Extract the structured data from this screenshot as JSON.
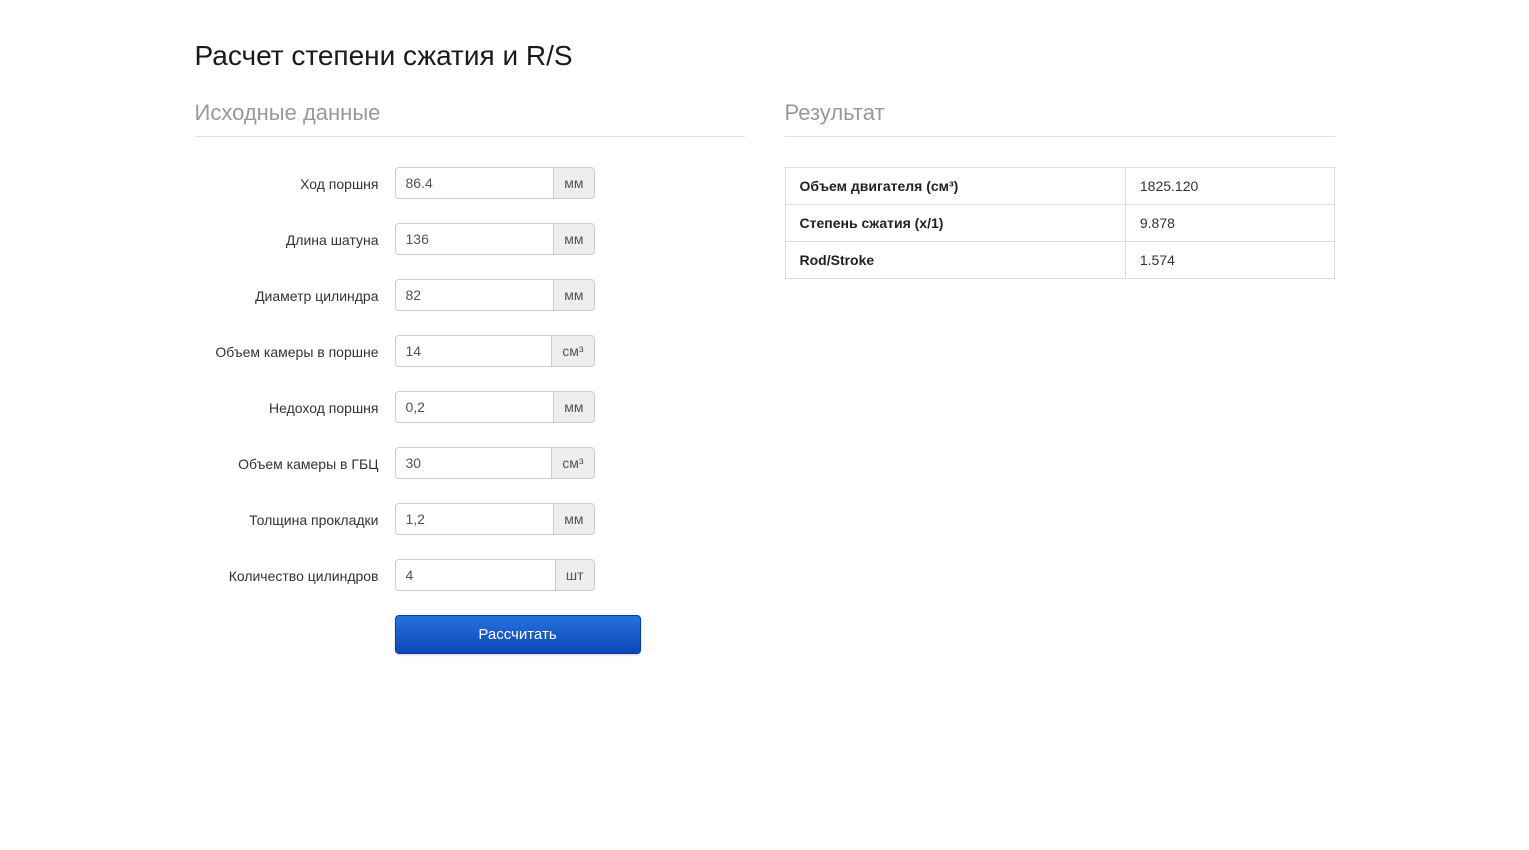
{
  "title": "Расчет степени сжатия и R/S",
  "sections": {
    "input": "Исходные данные",
    "result": "Результат"
  },
  "fields": {
    "stroke": {
      "label": "Ход поршня",
      "value": "86.4",
      "unit": "мм"
    },
    "rod_length": {
      "label": "Длина шатуна",
      "value": "136",
      "unit": "мм"
    },
    "bore": {
      "label": "Диаметр цилиндра",
      "value": "82",
      "unit": "мм"
    },
    "piston_chamber": {
      "label": "Объем камеры в поршне",
      "value": "14",
      "unit": "см³"
    },
    "deck_clearance": {
      "label": "Недоход поршня",
      "value": "0,2",
      "unit": "мм"
    },
    "head_chamber": {
      "label": "Объем камеры в ГБЦ",
      "value": "30",
      "unit": "см³"
    },
    "gasket_thickness": {
      "label": "Толщина прокладки",
      "value": "1,2",
      "unit": "мм"
    },
    "cylinders": {
      "label": "Количество цилиндров",
      "value": "4",
      "unit": "шт"
    }
  },
  "button": {
    "calculate": "Рассчитать"
  },
  "results": {
    "displacement": {
      "label": "Объем двигателя (см³)",
      "value": "1825.120"
    },
    "compression": {
      "label": "Степень сжатия (x/1)",
      "value": "9.878"
    },
    "rod_stroke": {
      "label": "Rod/Stroke",
      "value": "1.574"
    }
  }
}
